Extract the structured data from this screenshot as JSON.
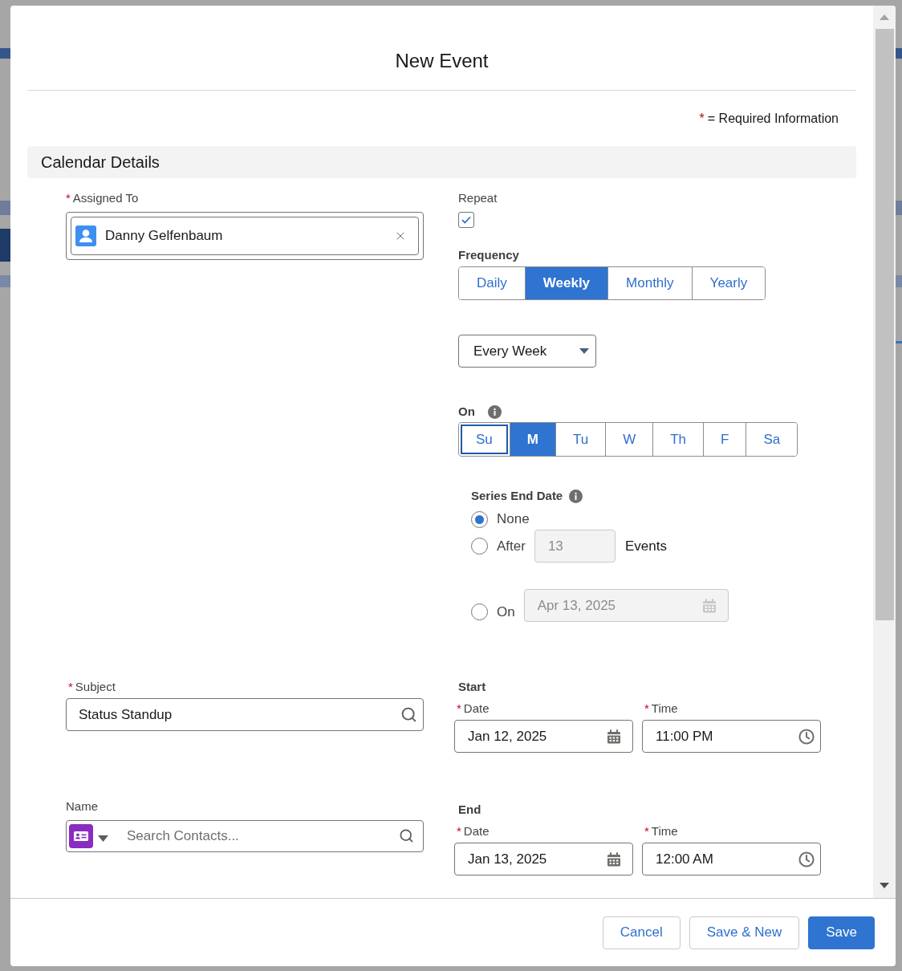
{
  "dialog": {
    "title": "New Event",
    "required_note": {
      "mark": "*",
      "text": "= Required Information"
    }
  },
  "section": {
    "title": "Calendar Details"
  },
  "assigned_to": {
    "mark": "*",
    "label": "Assigned To",
    "value": "Danny Gelfenbaum"
  },
  "repeat": {
    "label": "Repeat",
    "checked": true
  },
  "frequency": {
    "label": "Frequency",
    "options": [
      {
        "label": "Daily",
        "selected": false
      },
      {
        "label": "Weekly",
        "selected": true
      },
      {
        "label": "Monthly",
        "selected": false
      },
      {
        "label": "Yearly",
        "selected": false
      }
    ]
  },
  "interval": {
    "value": "Every Week"
  },
  "on_days": {
    "label": "On",
    "days": [
      {
        "label": "Su",
        "selected": false,
        "focused": true
      },
      {
        "label": "M",
        "selected": true,
        "focused": false
      },
      {
        "label": "Tu",
        "selected": false,
        "focused": false
      },
      {
        "label": "W",
        "selected": false,
        "focused": false
      },
      {
        "label": "Th",
        "selected": false,
        "focused": false
      },
      {
        "label": "F",
        "selected": false,
        "focused": false
      },
      {
        "label": "Sa",
        "selected": false,
        "focused": false
      }
    ]
  },
  "series_end": {
    "label": "Series End Date",
    "options": [
      {
        "kind": "plain",
        "label": "None",
        "selected": true
      },
      {
        "kind": "count",
        "label": "After",
        "value": "13",
        "disabled": true,
        "suffix": "Events",
        "selected": false
      },
      {
        "kind": "date",
        "label": "On",
        "value": "Apr 13, 2025",
        "disabled": true,
        "selected": false
      }
    ]
  },
  "subject": {
    "mark": "*",
    "label": "Subject",
    "value": "Status Standup"
  },
  "name": {
    "label": "Name",
    "placeholder": "Search Contacts..."
  },
  "start": {
    "label": "Start",
    "date": {
      "mark": "*",
      "label": "Date",
      "value": "Jan 12, 2025"
    },
    "time": {
      "mark": "*",
      "label": "Time",
      "value": "11:00 PM"
    }
  },
  "end": {
    "label": "End",
    "date": {
      "mark": "*",
      "label": "Date",
      "value": "Jan 13, 2025"
    },
    "time": {
      "mark": "*",
      "label": "Time",
      "value": "12:00 AM"
    }
  },
  "buttons": [
    {
      "label": "Cancel",
      "kind": "neutral"
    },
    {
      "label": "Save & New",
      "kind": "neutral"
    },
    {
      "label": "Save",
      "kind": "brand"
    }
  ]
}
